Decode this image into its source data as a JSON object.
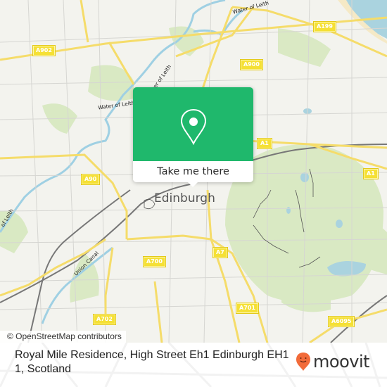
{
  "map": {
    "city_label": "Edinburgh",
    "road_labels": [
      {
        "id": "a902",
        "text": "A902"
      },
      {
        "id": "a199",
        "text": "A199"
      },
      {
        "id": "a900",
        "text": "A900"
      },
      {
        "id": "a1-north",
        "text": "A1"
      },
      {
        "id": "a1-east",
        "text": "A1"
      },
      {
        "id": "a90",
        "text": "A90"
      },
      {
        "id": "a7",
        "text": "A7"
      },
      {
        "id": "a700",
        "text": "A700"
      },
      {
        "id": "a702",
        "text": "A702"
      },
      {
        "id": "a701",
        "text": "A701"
      },
      {
        "id": "a6095",
        "text": "A6095"
      }
    ],
    "water_labels": {
      "water_of_leith_1": "Water of Leith",
      "water_of_leith_2": "Water of Leith",
      "water_of_leith_3": "Water of Leith",
      "water_of_leith_4": "of Leith",
      "union_canal": "Union Canal"
    },
    "attribution": "© OpenStreetMap contributors"
  },
  "popup": {
    "icon": "map-pin-icon",
    "action_label": "Take me there",
    "accent_color": "#1fb86c"
  },
  "footer": {
    "address": "Royal Mile Residence, High Street Eh1 Edinburgh EH1 1, Scotland",
    "brand": "moovit",
    "brand_color": "#f26b3a"
  }
}
